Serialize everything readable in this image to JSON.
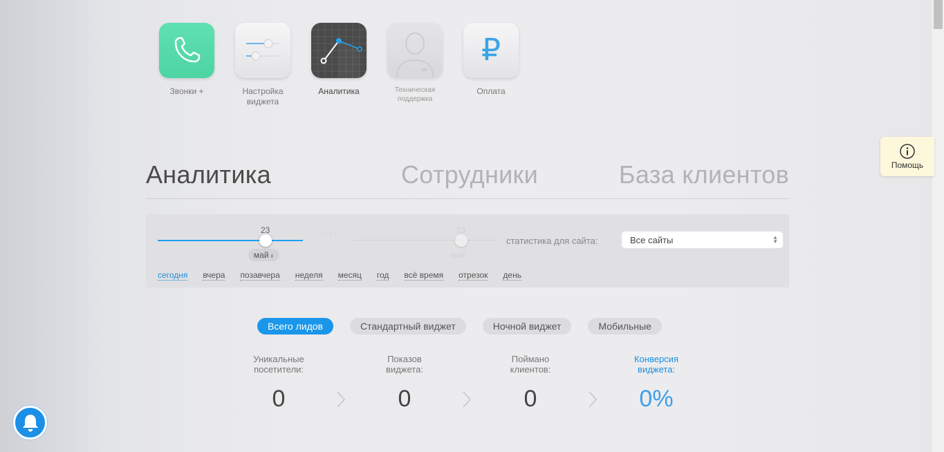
{
  "nav": {
    "calls": "Звонки +",
    "widget_settings_line1": "Настройка",
    "widget_settings_line2": "виджета",
    "analytics": "Аналитика",
    "support_line1": "Техническая",
    "support_line2": "поддержка",
    "payment": "Оплата",
    "payment_symbol": "₽"
  },
  "help": {
    "label": "Помощь"
  },
  "tabs": [
    "Аналитика",
    "Сотрудники",
    "База клиентов"
  ],
  "filter": {
    "start_day": "23",
    "end_day": "23",
    "year_ghost": "2014",
    "month": "май",
    "month_ghost": "май",
    "site_label": "статистика для сайта:",
    "site_value": "Все сайты",
    "periods": [
      "сегодня",
      "вчера",
      "позавчера",
      "неделя",
      "месяц",
      "год",
      "всё время",
      "отрезок",
      "день"
    ]
  },
  "widgets": [
    "Всего лидов",
    "Стандартный виджет",
    "Ночной виджет",
    "Мобильные"
  ],
  "stats": [
    {
      "line1": "Уникальные",
      "line2": "посетители:",
      "value": "0"
    },
    {
      "line1": "Показов",
      "line2": "виджета:",
      "value": "0"
    },
    {
      "line1": "Поймано",
      "line2": "клиентов:",
      "value": "0"
    },
    {
      "line1": "Конверсия",
      "line2": "виджета:",
      "value": "0%"
    }
  ],
  "colors": {
    "accent": "#1a96ea",
    "calls_tile": "#57dbaa",
    "help_bg": "#fdf8dc"
  }
}
